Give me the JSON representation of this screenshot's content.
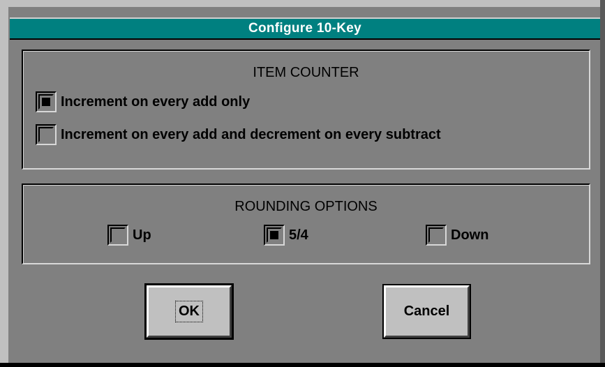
{
  "dialog": {
    "title": "Configure 10-Key"
  },
  "item_counter": {
    "heading": "ITEM COUNTER",
    "options": [
      {
        "label": "Increment on every add only",
        "checked": true
      },
      {
        "label": "Increment on every add and decrement on every subtract",
        "checked": false
      }
    ]
  },
  "rounding": {
    "heading": "ROUNDING OPTIONS",
    "options": [
      {
        "label": "Up",
        "checked": false
      },
      {
        "label": "5/4",
        "checked": true
      },
      {
        "label": "Down",
        "checked": false
      }
    ]
  },
  "buttons": {
    "ok_label": "OK",
    "cancel_label": "Cancel"
  },
  "colors": {
    "titlebar": "#008080",
    "dialog_bg": "#808080",
    "button_face": "#c0c0c0"
  }
}
